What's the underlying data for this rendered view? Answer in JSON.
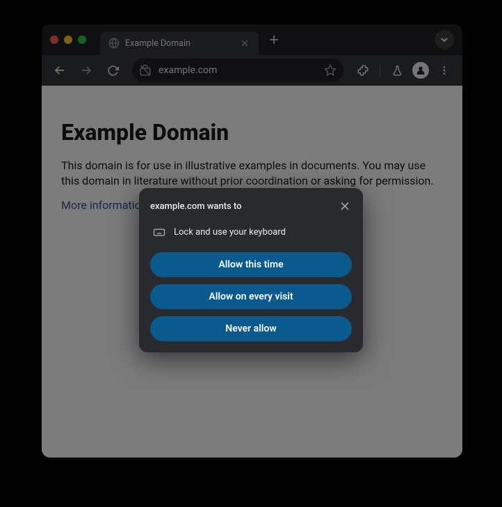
{
  "tab": {
    "title": "Example Domain"
  },
  "omnibox": {
    "url": "example.com"
  },
  "page": {
    "heading": "Example Domain",
    "paragraph": "This domain is for use in illustrative examples in documents. You may use this domain in literature without prior coordination or asking for permission.",
    "link_text": "More information..."
  },
  "dialog": {
    "title": "example.com wants to",
    "permission": "Lock and use your keyboard",
    "buttons": {
      "allow_once": "Allow this time",
      "allow_always": "Allow on every visit",
      "never": "Never allow"
    }
  }
}
